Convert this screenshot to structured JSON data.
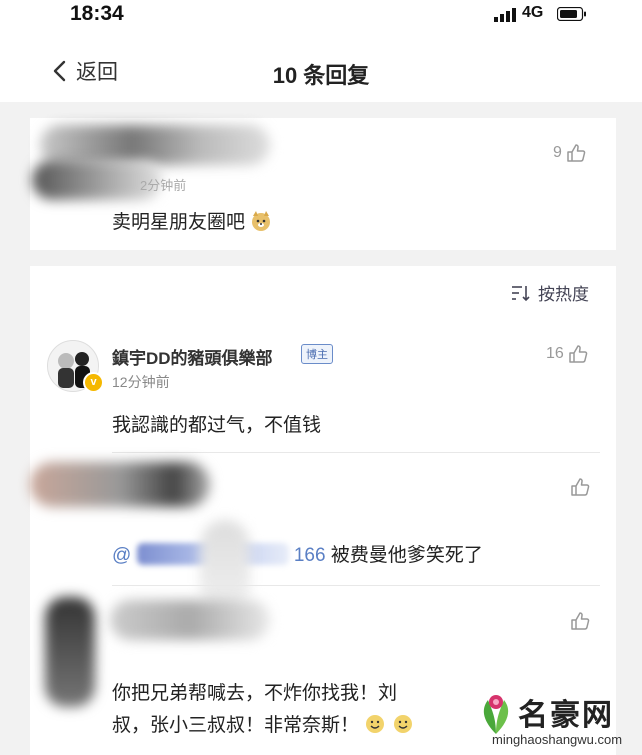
{
  "status_bar": {
    "time": "18:34",
    "network": "4G"
  },
  "nav": {
    "back_label": "返回",
    "title": "10 条回复"
  },
  "top_comment": {
    "time": "2分钟前",
    "likes": "9",
    "text": "卖明星朋友圈吧"
  },
  "sort": {
    "label": "按热度"
  },
  "reply1": {
    "username": "鎮宇DD的豬頭俱樂部",
    "badge": "博主",
    "time": "12分钟前",
    "likes": "16",
    "text": "我認識的都过气，不值钱"
  },
  "reply2": {
    "mention_at": "@",
    "mention_handle": "166",
    "text": " 被费曼他爹笑死了"
  },
  "reply3": {
    "line1": "你把兄弟帮喊去，不炸你找我！刘",
    "line2": "叔，张小三叔叔！非常奈斯！"
  },
  "watermark": {
    "title": "名豪网",
    "url": "minghaoshangwu.com"
  },
  "colors": {
    "link": "#5a7fc4",
    "vip_badge": "#f5b800",
    "watermark_leaf": "#4aa83a",
    "watermark_flower": "#d6336c"
  }
}
